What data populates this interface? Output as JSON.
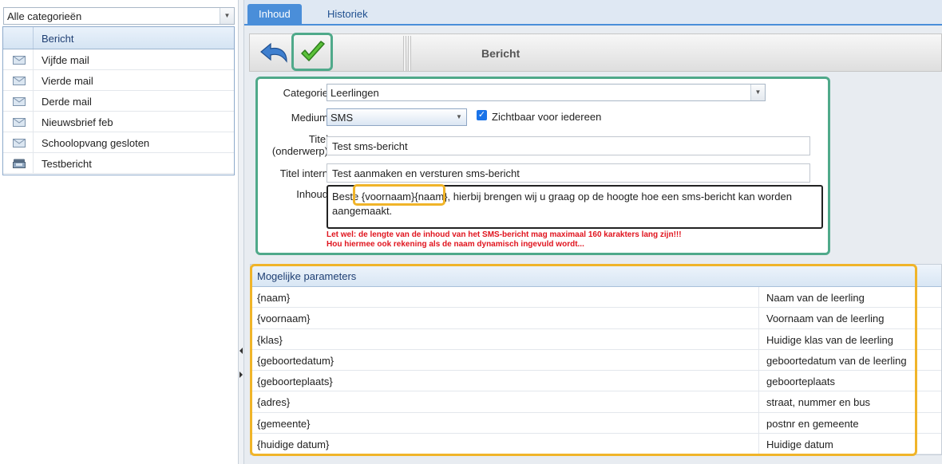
{
  "left": {
    "category_filter": "Alle categorieën",
    "column_header": "Bericht",
    "messages": [
      {
        "label": "Vijfde mail",
        "icon": "mail-icon"
      },
      {
        "label": "Vierde mail",
        "icon": "mail-icon"
      },
      {
        "label": "Derde mail",
        "icon": "mail-icon"
      },
      {
        "label": "Nieuwsbrief feb",
        "icon": "mail-icon"
      },
      {
        "label": "Schoolopvang gesloten",
        "icon": "mail-icon"
      },
      {
        "label": "Testbericht",
        "icon": "sms-phone-icon"
      }
    ]
  },
  "tabs": {
    "active": "Inhoud",
    "inactive": "Historiek"
  },
  "toolbar": {
    "title": "Bericht",
    "undo_icon": "undo-icon",
    "save_icon": "checkmark-icon"
  },
  "form": {
    "categorie_label": "Categorie",
    "categorie_value": "Leerlingen",
    "medium_label": "Medium",
    "medium_value": "SMS",
    "visible_label": "Zichtbaar voor iedereen",
    "visible_checked": true,
    "titel_label_1": "Titel",
    "titel_label_2": "(onderwerp)",
    "titel_value": "Test sms-bericht",
    "titel_intern_label": "Titel intern",
    "titel_intern_value": "Test aanmaken en versturen sms-bericht",
    "inhoud_label": "Inhoud",
    "inhoud_value": "Beste {voornaam}{naam}, hierbij brengen wij u graag op de hoogte hoe een sms-bericht kan worden aangemaakt.",
    "warning_1": "Let wel: de lengte van de inhoud van het SMS-bericht mag maximaal 160 karakters lang zijn!!!",
    "warning_2": "Hou hiermee ook rekening als de naam dynamisch ingevuld wordt..."
  },
  "params": {
    "header": "Mogelijke parameters",
    "rows": [
      {
        "key": "{naam}",
        "desc": "Naam van de leerling"
      },
      {
        "key": "{voornaam}",
        "desc": "Voornaam van de leerling"
      },
      {
        "key": "{klas}",
        "desc": "Huidige klas van de leerling"
      },
      {
        "key": "{geboortedatum}",
        "desc": "geboortedatum van de leerling"
      },
      {
        "key": "{geboorteplaats}",
        "desc": "geboorteplaats"
      },
      {
        "key": "{adres}",
        "desc": "straat, nummer en bus"
      },
      {
        "key": "{gemeente}",
        "desc": "postnr en gemeente"
      },
      {
        "key": "{huidige datum}",
        "desc": "Huidige datum"
      }
    ]
  },
  "colors": {
    "accent_blue": "#4a8ed9",
    "highlight_green": "#4fa98a",
    "highlight_orange": "#f0b429",
    "warning_red": "#e0141e"
  }
}
